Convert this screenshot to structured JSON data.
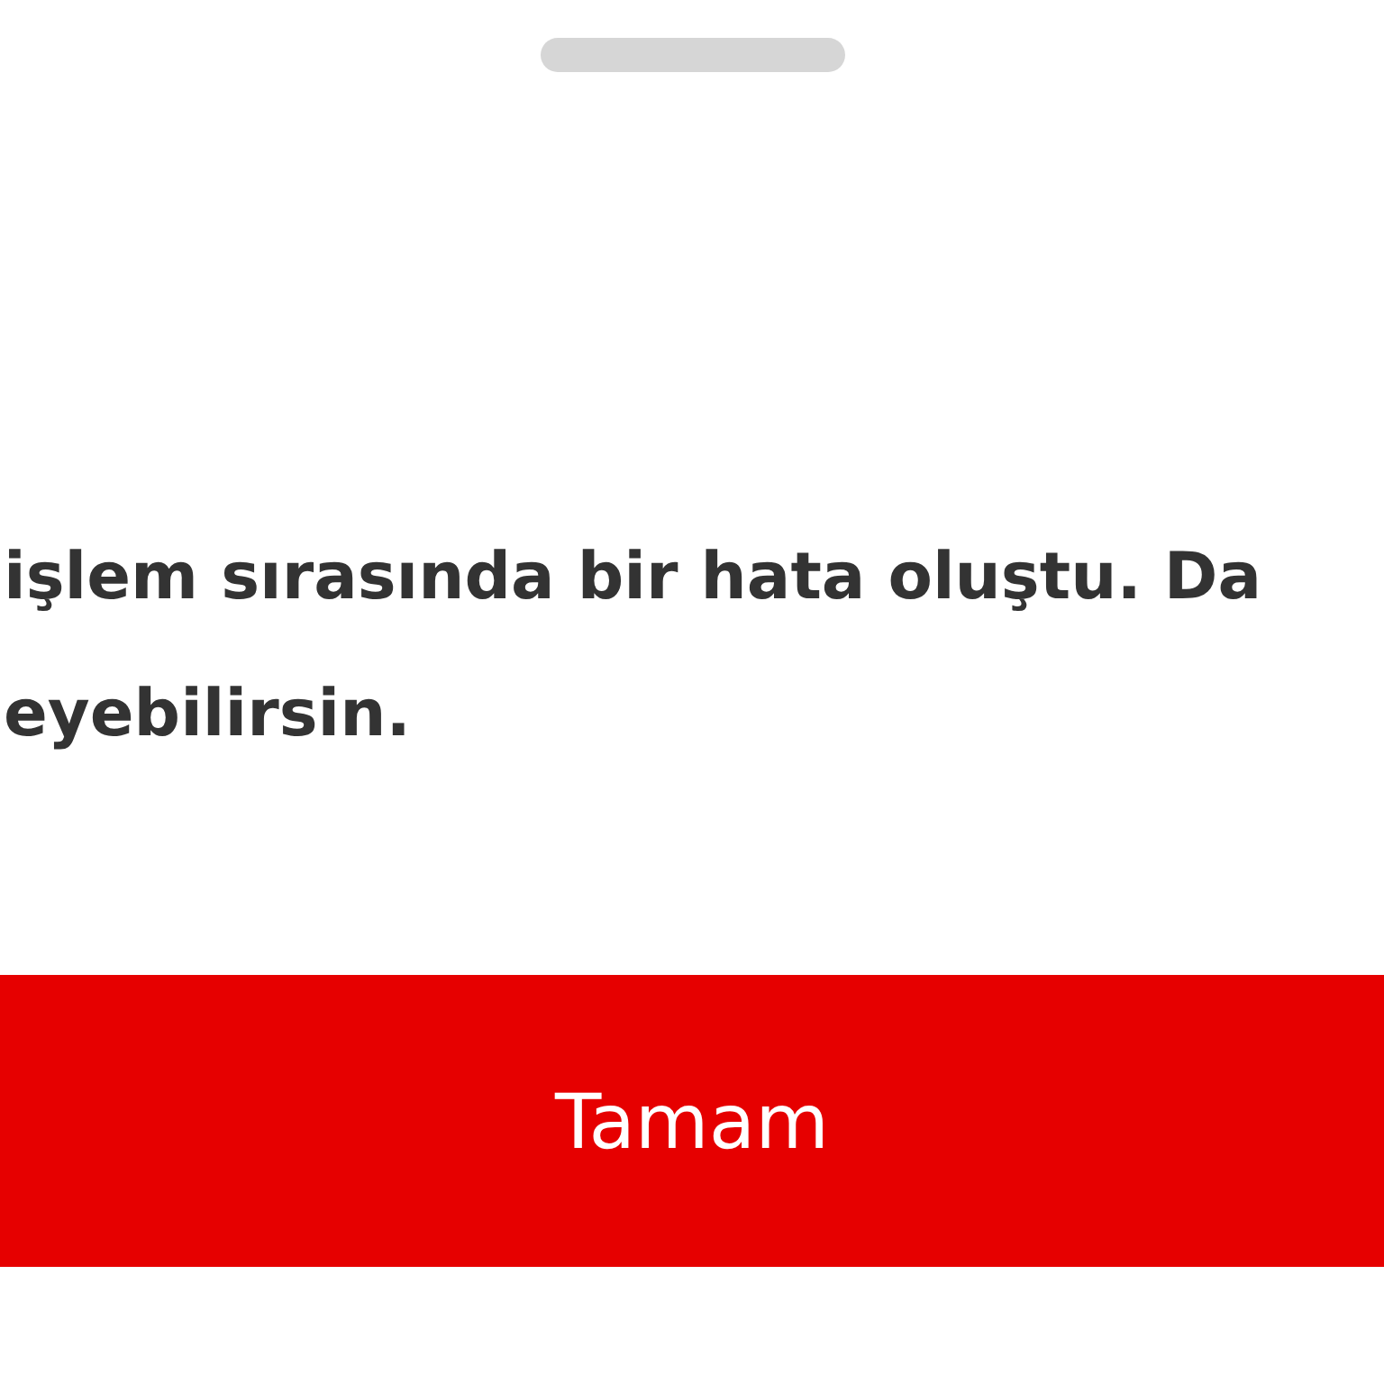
{
  "message": {
    "lines": [
      "işlem sırasında bir hata oluştu. Da",
      "eyebilirsin."
    ]
  },
  "button": {
    "label": "Tamam"
  }
}
